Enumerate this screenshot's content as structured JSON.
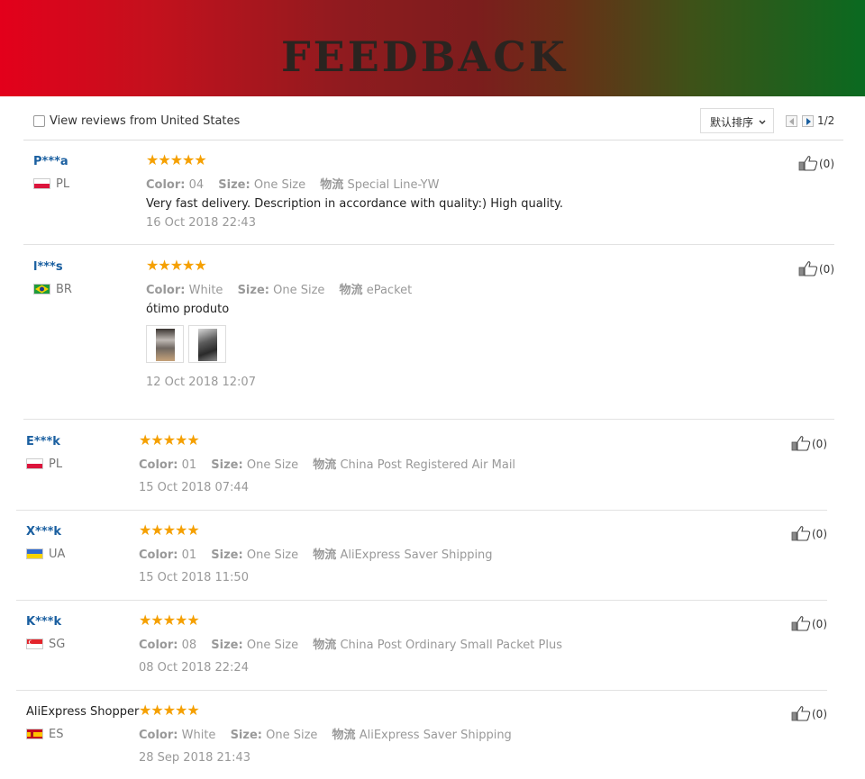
{
  "banner": {
    "title": "FEEDBACK"
  },
  "filter": {
    "checkbox_label": "View reviews from United States",
    "sort_label": "默认排序",
    "page_indicator": "1/2"
  },
  "labels": {
    "color": "Color:",
    "size": "Size:",
    "shipping": "物流"
  },
  "reviews": [
    {
      "user": "P***a",
      "country": "PL",
      "stars": "★★★★★",
      "rating": 5,
      "color": "04",
      "size": "One Size",
      "shipping": "Special Line-YW",
      "text": "Very fast delivery. Description in accordance with quality:) High quality.",
      "date": "16 Oct 2018 22:43",
      "likes": "(0)"
    },
    {
      "user": "l***s",
      "country": "BR",
      "stars": "★★★★★",
      "rating": 5,
      "color": "White",
      "size": "One Size",
      "shipping": "ePacket",
      "text": "ótimo produto",
      "date": "12 Oct 2018 12:07",
      "likes": "(0)"
    },
    {
      "user": "E***k",
      "country": "PL",
      "stars": "★★★★★",
      "rating": 5,
      "color": "01",
      "size": "One Size",
      "shipping": "China Post Registered Air Mail",
      "date": "15 Oct 2018 07:44",
      "likes": "(0)"
    },
    {
      "user": "X***k",
      "country": "UA",
      "stars": "★★★★★",
      "rating": 5,
      "color": "01",
      "size": "One Size",
      "shipping": "AliExpress Saver Shipping",
      "date": "15 Oct 2018 11:50",
      "likes": "(0)"
    },
    {
      "user": "K***k",
      "country": "SG",
      "stars": "★★★★★",
      "rating": 5,
      "color": "08",
      "size": "One Size",
      "shipping": "China Post Ordinary Small Packet Plus",
      "date": "08 Oct 2018 22:24",
      "likes": "(0)"
    },
    {
      "user": "AliExpress Shopper",
      "country": "ES",
      "stars": "★★★★★",
      "rating": 5,
      "color": "White",
      "size": "One Size",
      "shipping": "AliExpress Saver Shipping",
      "date": "28 Sep 2018 21:43",
      "likes": "(0)"
    }
  ],
  "colors": {
    "star": "#f5a000",
    "username": "#1a5fa0",
    "muted": "#999999"
  },
  "icons": {
    "like": "thumbs-up-icon",
    "flag": "country-flag-icon",
    "star": "star-icon"
  }
}
